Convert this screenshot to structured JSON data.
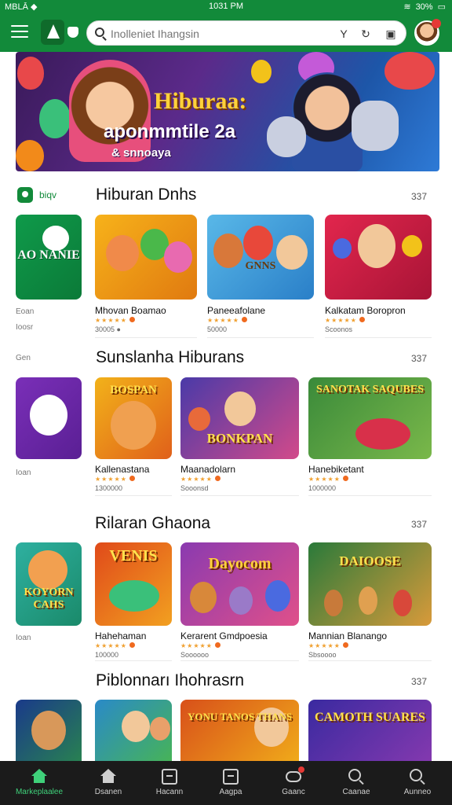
{
  "status": {
    "carrier": "MBLĀ ◆",
    "time": "1031 PM",
    "battery": "30%"
  },
  "header": {
    "search_placeholder": "Inolleniet Ihangsin",
    "search_right_glyph": "Y"
  },
  "banner": {
    "title": "Hiburaa:",
    "subtitle": "aponmmtile 2a",
    "tagline": "& snnoaya"
  },
  "sections": [
    {
      "title": "Hiburan Dnhs",
      "count": "337",
      "brand_label": "biqv",
      "side_labels": [
        "Eoan",
        "Ioosr"
      ],
      "cards": [
        {
          "name": "",
          "rating": "",
          "meta": "",
          "thumb_text": "AO NANIE",
          "colors": [
            "#0f9a4a",
            "#0b7a38"
          ]
        },
        {
          "name": "Mhovan Boamao",
          "rating": "★★★★★",
          "meta": "30005 ●",
          "thumb_text": "",
          "colors": [
            "#f7b21a",
            "#e07a10"
          ]
        },
        {
          "name": "Paneeafolane",
          "rating": "★★★★★",
          "meta": "50000",
          "thumb_text": "GNNS",
          "colors": [
            "#59b8e8",
            "#2a7fc8"
          ]
        },
        {
          "name": "Kalkatam Boropron",
          "rating": "★★★★★",
          "meta": "Scoonos",
          "thumb_text": "",
          "colors": [
            "#e2264d",
            "#a81436"
          ]
        }
      ]
    },
    {
      "title": "Sunslanha Hiburans",
      "count": "337",
      "side_labels": [
        "Gen",
        "Ioan"
      ],
      "cards": [
        {
          "name": "",
          "rating": "",
          "meta": "",
          "thumb_text": "",
          "colors": [
            "#7a2fb8",
            "#5a1f94"
          ]
        },
        {
          "name": "Kallenastana",
          "rating": "★★★★★",
          "meta": "1300000",
          "thumb_text": "BOSPAN",
          "colors": [
            "#f2b21a",
            "#e0601a"
          ]
        },
        {
          "name": "Maanadolarn",
          "rating": "★★★★★",
          "meta": "Sooonsd",
          "thumb_text": "BONKPAN",
          "colors": [
            "#4a3aa8",
            "#d24a8a"
          ]
        },
        {
          "name": "Hanebiketant",
          "rating": "★★★★★",
          "meta": "1000000",
          "thumb_text": "SANOTAK SAQUBES",
          "colors": [
            "#3a8a3a",
            "#7ab84a"
          ]
        }
      ]
    },
    {
      "title": "Rilaran Ghaona",
      "count": "337",
      "side_labels": [
        "Ioan"
      ],
      "cards": [
        {
          "name": "",
          "rating": "",
          "meta": "",
          "thumb_text": "KOYORN CAHS",
          "colors": [
            "#2eb0a0",
            "#1a8a6a"
          ]
        },
        {
          "name": "Hahehaman",
          "rating": "★★★★★",
          "meta": "100000",
          "thumb_text": "VENIS",
          "colors": [
            "#e04a1a",
            "#f2a020"
          ]
        },
        {
          "name": "Kerarent Gmdpoesia",
          "rating": "★★★★★",
          "meta": "Soooooo",
          "thumb_text": "Dayocom",
          "colors": [
            "#8a3ab0",
            "#e0508a"
          ]
        },
        {
          "name": "Mannian Blanango",
          "rating": "★★★★★",
          "meta": "Sbsoooo",
          "thumb_text": "DAIOOSE",
          "colors": [
            "#2a7a3a",
            "#d89a3a"
          ]
        }
      ]
    },
    {
      "title": "Piblonnarı Ihohrasrn",
      "count": "337",
      "cards": [
        {
          "name": "",
          "rating": "",
          "meta": "",
          "thumb_text": "",
          "colors": [
            "#1a3a8a",
            "#2a8a4a"
          ]
        },
        {
          "name": "",
          "rating": "",
          "meta": "",
          "thumb_text": "",
          "colors": [
            "#2a8ac8",
            "#4ab84a"
          ]
        },
        {
          "name": "",
          "rating": "",
          "meta": "",
          "thumb_text": "YONU TANOS THANS",
          "colors": [
            "#d8501a",
            "#f2b21a"
          ]
        },
        {
          "name": "",
          "rating": "",
          "meta": "",
          "thumb_text": "CAMOTH SUARES",
          "colors": [
            "#3a2aa0",
            "#8a3ab0"
          ]
        }
      ]
    }
  ],
  "nav": [
    {
      "label": "Markeplaalee",
      "icon": "home-icon"
    },
    {
      "label": "Dsanen",
      "icon": "home-icon"
    },
    {
      "label": "Hacann",
      "icon": "box-icon"
    },
    {
      "label": "Aagpa",
      "icon": "box-icon"
    },
    {
      "label": "Gaanc",
      "icon": "gamepad-icon"
    },
    {
      "label": "Caanae",
      "icon": "search-icon"
    },
    {
      "label": "Aunneo",
      "icon": "search-icon"
    }
  ],
  "colors": {
    "brand": "#128a3a",
    "nav_bg": "#1b1b1b",
    "nav_active": "#3fd17a"
  }
}
